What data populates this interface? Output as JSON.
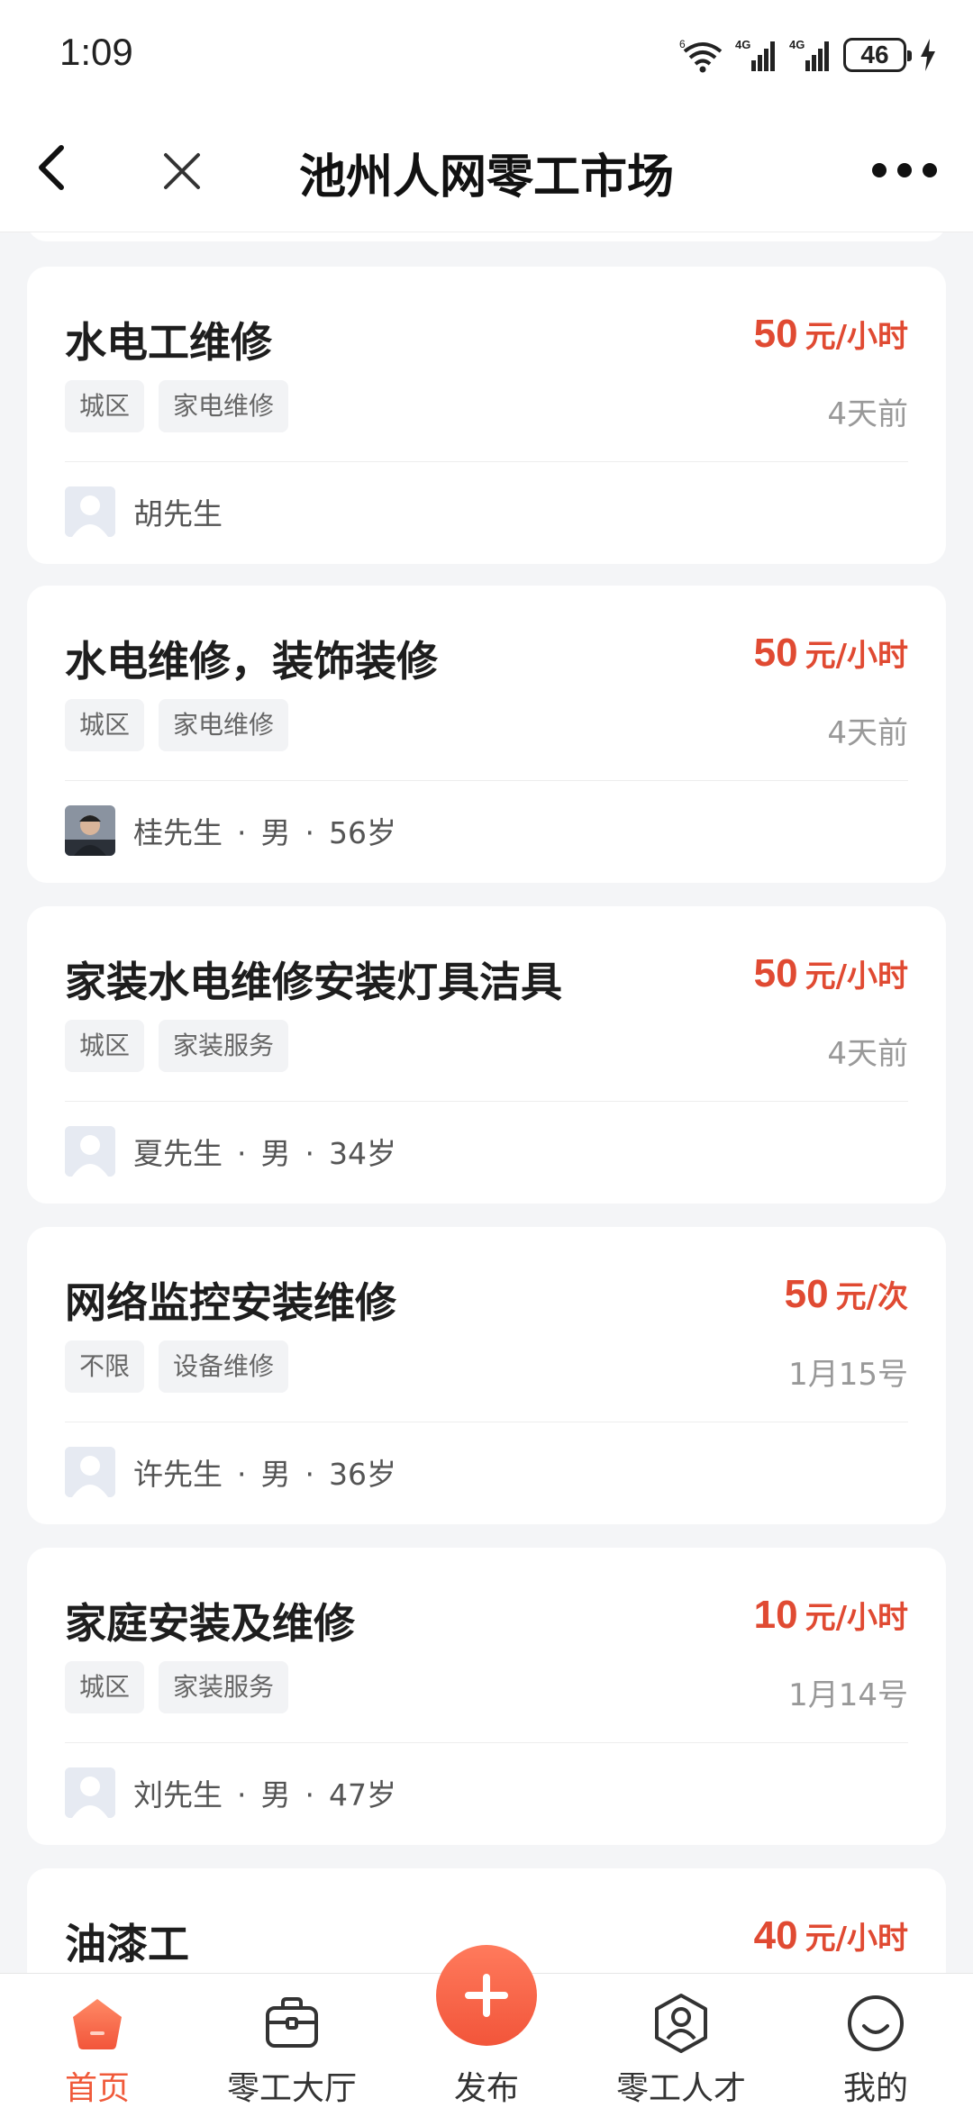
{
  "status_bar": {
    "time": "1:09",
    "battery": "46",
    "icons": [
      "wifi-6-icon",
      "signal-4g-icon",
      "signal-4g-icon",
      "battery-icon",
      "charging-icon"
    ]
  },
  "nav": {
    "title": "池州人网零工市场",
    "icons": [
      "back-arrow-icon",
      "close-icon",
      "more-dots-icon"
    ]
  },
  "colors": {
    "accent": "#e04a32",
    "tab_active": "#f05a3a",
    "background": "#f4f5f7"
  },
  "jobs": [
    {
      "title": "水电工维修",
      "price": "50",
      "unit": "元/小时",
      "tags": [
        "城区",
        "家电维修"
      ],
      "date": "4天前",
      "poster": {
        "name": "胡先生",
        "avatar": "default-avatar-icon"
      }
    },
    {
      "title": "水电维修，装饰装修",
      "price": "50",
      "unit": "元/小时",
      "tags": [
        "城区",
        "家电维修"
      ],
      "date": "4天前",
      "poster": {
        "name": "桂先生",
        "gender": "男",
        "age": "56岁",
        "avatar": "photo-avatar"
      }
    },
    {
      "title": "家装水电维修安装灯具洁具",
      "price": "50",
      "unit": "元/小时",
      "tags": [
        "城区",
        "家装服务"
      ],
      "date": "4天前",
      "poster": {
        "name": "夏先生",
        "gender": "男",
        "age": "34岁",
        "avatar": "default-avatar-icon"
      }
    },
    {
      "title": "网络监控安装维修",
      "price": "50",
      "unit": "元/次",
      "tags": [
        "不限",
        "设备维修"
      ],
      "date": "1月15号",
      "poster": {
        "name": "许先生",
        "gender": "男",
        "age": "36岁",
        "avatar": "default-avatar-icon"
      }
    },
    {
      "title": "家庭安装及维修",
      "price": "10",
      "unit": "元/小时",
      "tags": [
        "城区",
        "家装服务"
      ],
      "date": "1月14号",
      "poster": {
        "name": "刘先生",
        "gender": "男",
        "age": "47岁",
        "avatar": "default-avatar-icon"
      }
    },
    {
      "title": "油漆工",
      "price": "40",
      "unit": "元/小时"
    }
  ],
  "tabbar": {
    "items": [
      {
        "label": "首页",
        "icon": "home-icon",
        "active": true
      },
      {
        "label": "零工大厅",
        "icon": "briefcase-icon",
        "active": false
      },
      {
        "label": "发布",
        "icon": "plus-icon",
        "active": false
      },
      {
        "label": "零工人才",
        "icon": "user-badge-icon",
        "active": false
      },
      {
        "label": "我的",
        "icon": "smiley-icon",
        "active": false
      }
    ]
  }
}
